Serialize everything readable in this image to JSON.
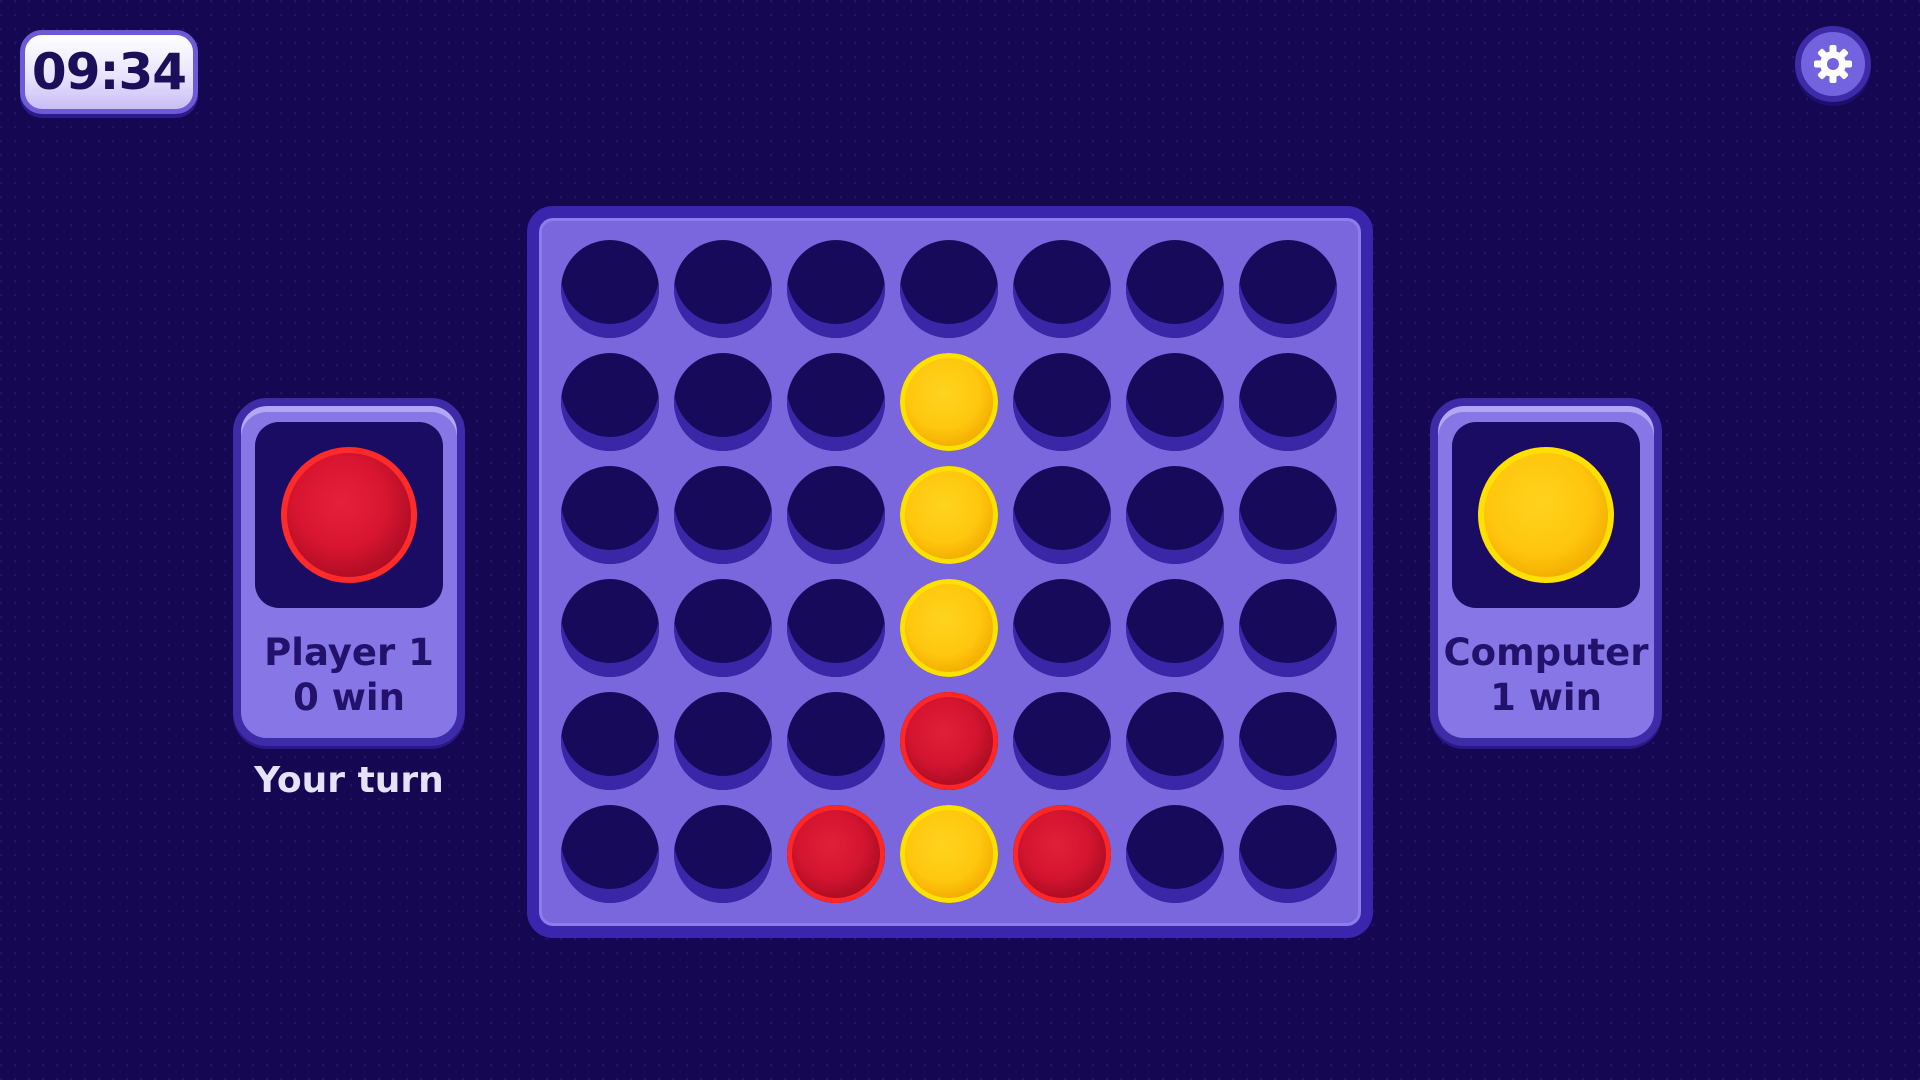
{
  "timer": {
    "text": "09:34"
  },
  "settings": {
    "icon": "gear-icon"
  },
  "players": [
    {
      "name": "Player 1",
      "wins_text": "0 win",
      "token_color": "red"
    },
    {
      "name": "Computer",
      "wins_text": "1 win",
      "token_color": "yellow"
    }
  ],
  "turn_label": "Your turn",
  "colors": {
    "background": "#150752",
    "board": "#7a67de",
    "board_border": "#3a26ad",
    "hole": "#170a5a",
    "red": "#d81530",
    "yellow": "#ffc60d"
  },
  "board": {
    "rows": 6,
    "cols": 7,
    "cells": [
      [
        "",
        "",
        "",
        "",
        "",
        "",
        ""
      ],
      [
        "",
        "",
        "",
        "yellow",
        "",
        "",
        ""
      ],
      [
        "",
        "",
        "",
        "yellow",
        "",
        "",
        ""
      ],
      [
        "",
        "",
        "",
        "yellow",
        "",
        "",
        ""
      ],
      [
        "",
        "",
        "",
        "red",
        "",
        "",
        ""
      ],
      [
        "",
        "",
        "red",
        "yellow",
        "red",
        "",
        ""
      ]
    ]
  }
}
